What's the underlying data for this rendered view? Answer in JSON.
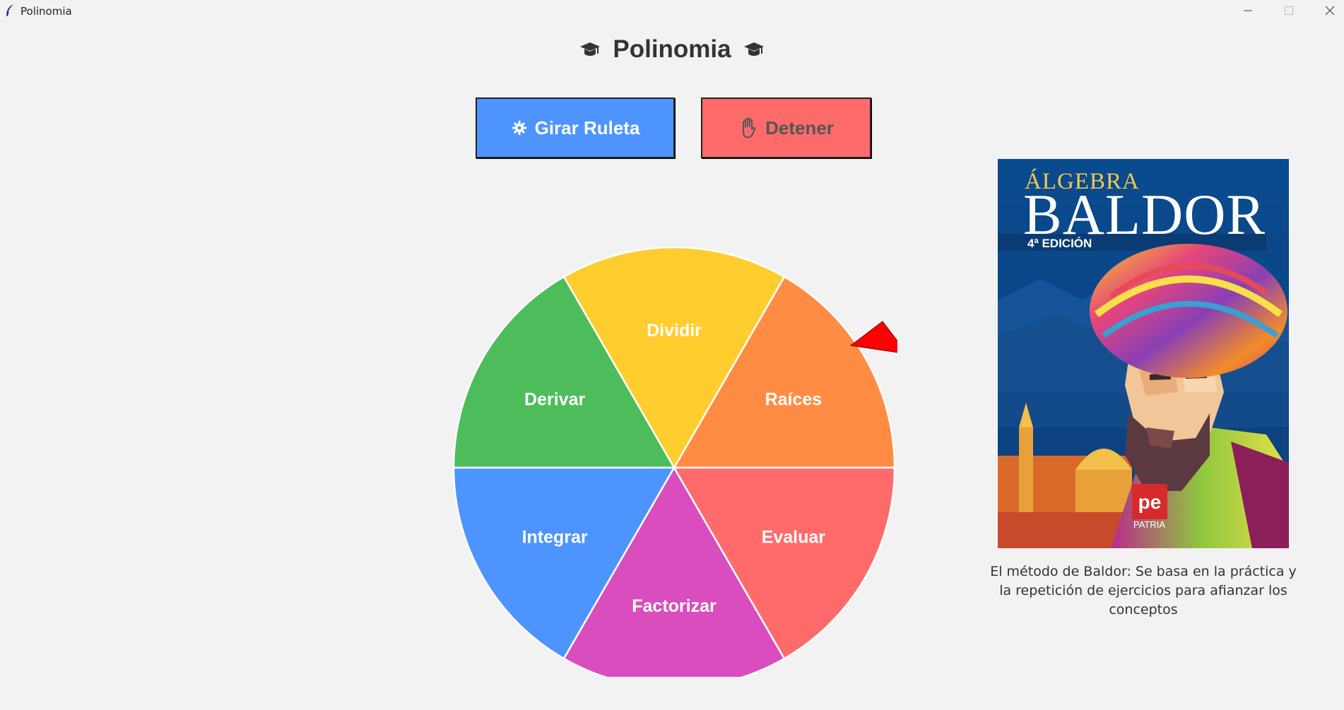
{
  "window": {
    "title": "Polinomia",
    "controls": {
      "minimize": "─",
      "maximize": "☐",
      "close": "✕"
    }
  },
  "header": {
    "title": "Polinomia",
    "left_icon": "graduation-cap-icon",
    "right_icon": "graduation-cap-icon"
  },
  "buttons": {
    "spin": {
      "label": "Girar Ruleta",
      "icon": "gear-icon",
      "color": "#4d94ff"
    },
    "stop": {
      "label": "Detener",
      "icon": "hand-icon",
      "color": "#ff6b6b"
    }
  },
  "wheel": {
    "pointer_color": "#ff0000",
    "segments": [
      {
        "label": "Raíces",
        "color": "#ff8c42"
      },
      {
        "label": "Dividir",
        "color": "#ffcd2e"
      },
      {
        "label": "Derivar",
        "color": "#4cbd5a"
      },
      {
        "label": "Integrar",
        "color": "#4d94ff"
      },
      {
        "label": "Factorizar",
        "color": "#d94dbf"
      },
      {
        "label": "Evaluar",
        "color": "#ff6b6b"
      }
    ]
  },
  "book": {
    "title_top": "ÁLGEBRA",
    "title_main": "BALDOR",
    "edition": "4ª EDICIÓN",
    "publisher": "PATRIA",
    "caption": "El método de Baldor: Se basa en la práctica y la repetición de ejercicios para afianzar los conceptos"
  }
}
